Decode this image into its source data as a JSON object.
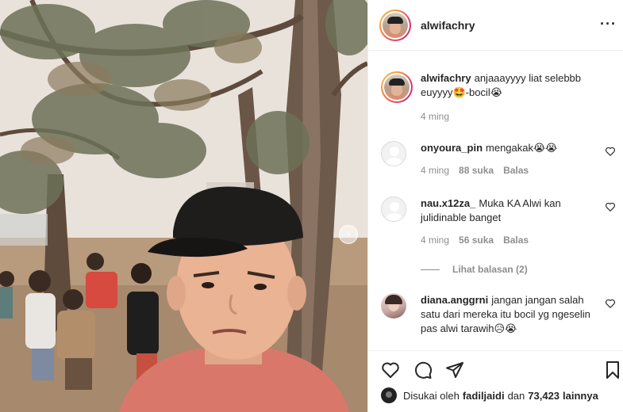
{
  "post": {
    "username": "alwifachry",
    "more_icon": "more-horizontal-icon",
    "caption": {
      "username": "alwifachry",
      "text": "anjaaayyyy liat selebbb euyyyy🤩-bocil😭",
      "time": "4 ming"
    }
  },
  "comments": [
    {
      "username": "onyoura_pin",
      "text": "mengakak😭😭",
      "time": "4 ming",
      "likes": "88 suka",
      "reply_label": "Balas"
    },
    {
      "username": "nau.x12za_",
      "text": "Muka KA Alwi kan julidinable banget",
      "time": "4 ming",
      "likes": "56 suka",
      "reply_label": "Balas",
      "view_replies": "Lihat balasan (2)"
    },
    {
      "username": "diana.anggrni",
      "text": "jangan jangan salah satu dari mereka itu bocil yg ngeselin pas alwi tarawih😥😭"
    }
  ],
  "footer": {
    "liked_by_prefix": "Disukai oleh",
    "liked_by_user": "fadiljaidi",
    "liked_by_and": "dan",
    "liked_by_count": "73,423",
    "liked_by_suffix": "lainnya"
  },
  "colors": {
    "text": "#262626",
    "muted": "#8e8e8e",
    "border": "#efefef"
  }
}
